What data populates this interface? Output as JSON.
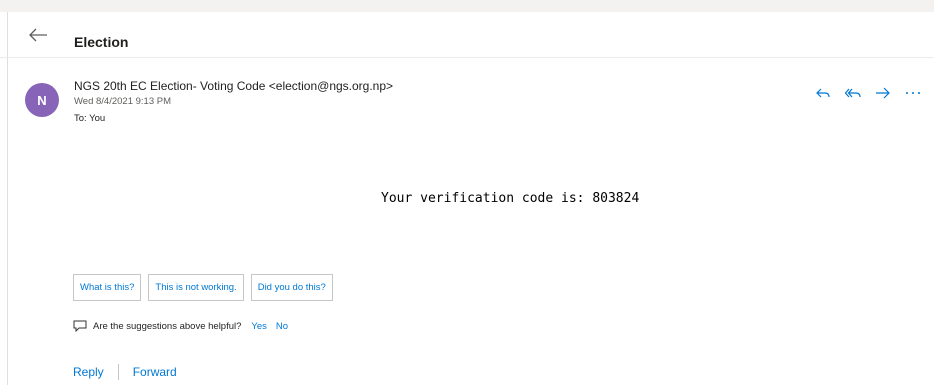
{
  "header": {
    "title": "Election"
  },
  "message": {
    "avatar_letter": "N",
    "sender": "NGS 20th EC Election- Voting Code <election@ngs.org.np>",
    "date": "Wed 8/4/2021 9:13 PM",
    "to": "To: You",
    "body": "Your verification code is: 803824"
  },
  "suggestions": [
    "What is this?",
    "This is not working.",
    "Did you do this?"
  ],
  "feedback": {
    "question": "Are the suggestions above helpful?",
    "yes": "Yes",
    "no": "No"
  },
  "footer": {
    "reply": "Reply",
    "forward": "Forward"
  },
  "colors": {
    "accent": "#0078d4",
    "avatar": "#8764b8"
  },
  "icons": [
    "back-arrow-icon",
    "reply-icon",
    "reply-all-icon",
    "forward-icon",
    "more-icon",
    "feedback-icon"
  ]
}
